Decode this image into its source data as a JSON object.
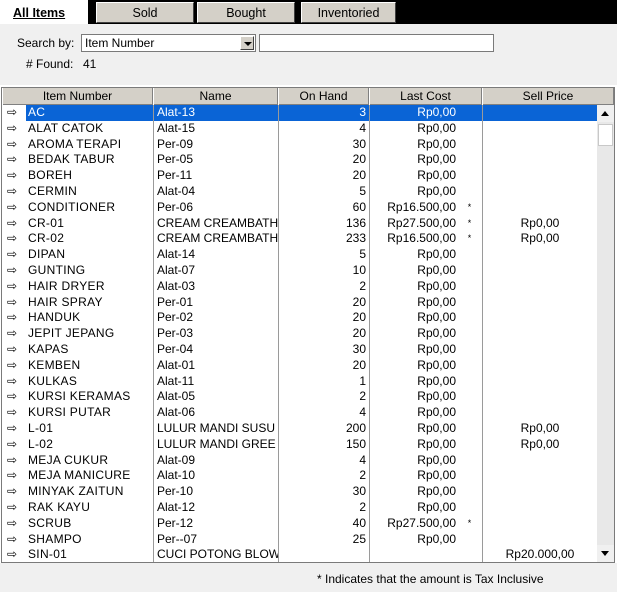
{
  "tabs": [
    {
      "label": "All Items",
      "active": true
    },
    {
      "label": "Sold",
      "active": false
    },
    {
      "label": "Bought",
      "active": false
    },
    {
      "label": "Inventoried",
      "active": false
    }
  ],
  "search": {
    "label": "Search by:",
    "field": "Item Number",
    "query": ""
  },
  "found": {
    "label": "# Found:",
    "count": "41"
  },
  "columns": [
    "Item Number",
    "Name",
    "On Hand",
    "Last Cost",
    "Sell Price"
  ],
  "rows": [
    {
      "item": "AC",
      "name": "Alat-13",
      "on_hand": "3",
      "last_cost": "Rp0,00",
      "tax": "",
      "sell_price": ""
    },
    {
      "item": "ALAT CATOK",
      "name": "Alat-15",
      "on_hand": "4",
      "last_cost": "Rp0,00",
      "tax": "",
      "sell_price": ""
    },
    {
      "item": "AROMA TERAPI",
      "name": "Per-09",
      "on_hand": "30",
      "last_cost": "Rp0,00",
      "tax": "",
      "sell_price": ""
    },
    {
      "item": "BEDAK TABUR",
      "name": "Per-05",
      "on_hand": "20",
      "last_cost": "Rp0,00",
      "tax": "",
      "sell_price": ""
    },
    {
      "item": "BOREH",
      "name": "Per-11",
      "on_hand": "20",
      "last_cost": "Rp0,00",
      "tax": "",
      "sell_price": ""
    },
    {
      "item": "CERMIN",
      "name": "Alat-04",
      "on_hand": "5",
      "last_cost": "Rp0,00",
      "tax": "",
      "sell_price": ""
    },
    {
      "item": "CONDITIONER",
      "name": "Per-06",
      "on_hand": "60",
      "last_cost": "Rp16.500,00",
      "tax": "*",
      "sell_price": ""
    },
    {
      "item": "CR-01",
      "name": "CREAM CREAMBATH",
      "on_hand": "136",
      "last_cost": "Rp27.500,00",
      "tax": "*",
      "sell_price": "Rp0,00"
    },
    {
      "item": "CR-02",
      "name": "CREAM CREAMBATH",
      "on_hand": "233",
      "last_cost": "Rp16.500,00",
      "tax": "*",
      "sell_price": "Rp0,00"
    },
    {
      "item": "DIPAN",
      "name": "Alat-14",
      "on_hand": "5",
      "last_cost": "Rp0,00",
      "tax": "",
      "sell_price": ""
    },
    {
      "item": "GUNTING",
      "name": "Alat-07",
      "on_hand": "10",
      "last_cost": "Rp0,00",
      "tax": "",
      "sell_price": ""
    },
    {
      "item": "HAIR DRYER",
      "name": "Alat-03",
      "on_hand": "2",
      "last_cost": "Rp0,00",
      "tax": "",
      "sell_price": ""
    },
    {
      "item": "HAIR SPRAY",
      "name": "Per-01",
      "on_hand": "20",
      "last_cost": "Rp0,00",
      "tax": "",
      "sell_price": ""
    },
    {
      "item": "HANDUK",
      "name": "Per-02",
      "on_hand": "20",
      "last_cost": "Rp0,00",
      "tax": "",
      "sell_price": ""
    },
    {
      "item": "JEPIT JEPANG",
      "name": "Per-03",
      "on_hand": "20",
      "last_cost": "Rp0,00",
      "tax": "",
      "sell_price": ""
    },
    {
      "item": "KAPAS",
      "name": "Per-04",
      "on_hand": "30",
      "last_cost": "Rp0,00",
      "tax": "",
      "sell_price": ""
    },
    {
      "item": "KEMBEN",
      "name": "Alat-01",
      "on_hand": "20",
      "last_cost": "Rp0,00",
      "tax": "",
      "sell_price": ""
    },
    {
      "item": "KULKAS",
      "name": "Alat-11",
      "on_hand": "1",
      "last_cost": "Rp0,00",
      "tax": "",
      "sell_price": ""
    },
    {
      "item": "KURSI KERAMAS",
      "name": "Alat-05",
      "on_hand": "2",
      "last_cost": "Rp0,00",
      "tax": "",
      "sell_price": ""
    },
    {
      "item": "KURSI PUTAR",
      "name": "Alat-06",
      "on_hand": "4",
      "last_cost": "Rp0,00",
      "tax": "",
      "sell_price": ""
    },
    {
      "item": "L-01",
      "name": "LULUR MANDI SUSU",
      "on_hand": "200",
      "last_cost": "Rp0,00",
      "tax": "",
      "sell_price": "Rp0,00"
    },
    {
      "item": "L-02",
      "name": "LULUR MANDI GREE",
      "on_hand": "150",
      "last_cost": "Rp0,00",
      "tax": "",
      "sell_price": "Rp0,00"
    },
    {
      "item": "MEJA CUKUR",
      "name": "Alat-09",
      "on_hand": "4",
      "last_cost": "Rp0,00",
      "tax": "",
      "sell_price": ""
    },
    {
      "item": "MEJA MANICURE",
      "name": "Alat-10",
      "on_hand": "2",
      "last_cost": "Rp0,00",
      "tax": "",
      "sell_price": ""
    },
    {
      "item": "MINYAK ZAITUN",
      "name": "Per-10",
      "on_hand": "30",
      "last_cost": "Rp0,00",
      "tax": "",
      "sell_price": ""
    },
    {
      "item": "RAK KAYU",
      "name": "Alat-12",
      "on_hand": "2",
      "last_cost": "Rp0,00",
      "tax": "",
      "sell_price": ""
    },
    {
      "item": "SCRUB",
      "name": "Per-12",
      "on_hand": "40",
      "last_cost": "Rp27.500,00",
      "tax": "*",
      "sell_price": ""
    },
    {
      "item": "SHAMPO",
      "name": "Per--07",
      "on_hand": "25",
      "last_cost": "Rp0,00",
      "tax": "",
      "sell_price": ""
    },
    {
      "item": "SIN-01",
      "name": "CUCI POTONG BLOW",
      "on_hand": "",
      "last_cost": "",
      "tax": "",
      "sell_price": "Rp20.000,00"
    }
  ],
  "selected_row": 0,
  "footnote": "* Indicates that the amount is Tax Inclusive",
  "colors": {
    "selection": "#0a64d6",
    "header_bg": "#d4d0c8",
    "tab_strip": "#000000"
  }
}
